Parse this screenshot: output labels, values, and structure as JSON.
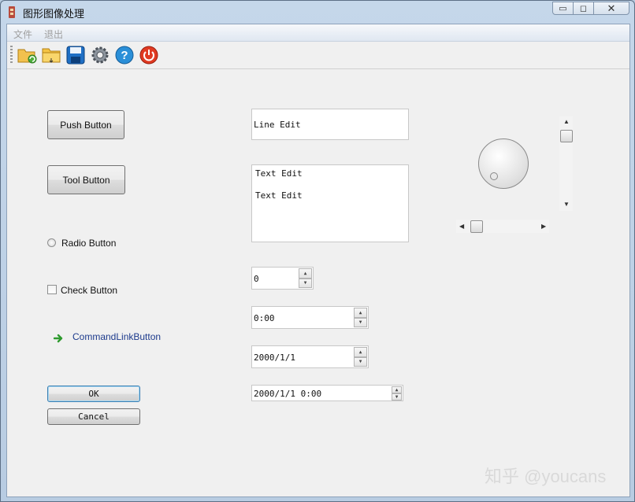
{
  "window": {
    "title": "图形图像处理",
    "caption_min": "▭",
    "caption_max": "◻",
    "caption_close": "✕"
  },
  "menu": [
    "文件",
    "退出"
  ],
  "toolbar": {
    "icons": [
      "folder-open-icon",
      "folder-icon",
      "save-icon",
      "settings-icon",
      "help-icon",
      "power-icon"
    ]
  },
  "widgets": {
    "push_button": "Push Button",
    "tool_button": "Tool Button",
    "radio_button": "Radio Button",
    "check_button": "Check Button",
    "command_link": "CommandLinkButton",
    "ok": "OK",
    "cancel": "Cancel",
    "line_edit": "Line Edit",
    "text_edit_line1": "Text Edit",
    "text_edit_line2": "Text Edit",
    "spin_box": "0",
    "time_edit": "0:00",
    "date_edit": "2000/1/1",
    "datetime_edit": "2000/1/1 0:00"
  },
  "watermark": "知乎 @youcans",
  "colors": {
    "accent": "#3c7fb1",
    "link": "#1c3a8c",
    "arrow_green": "#2e9a2e"
  }
}
